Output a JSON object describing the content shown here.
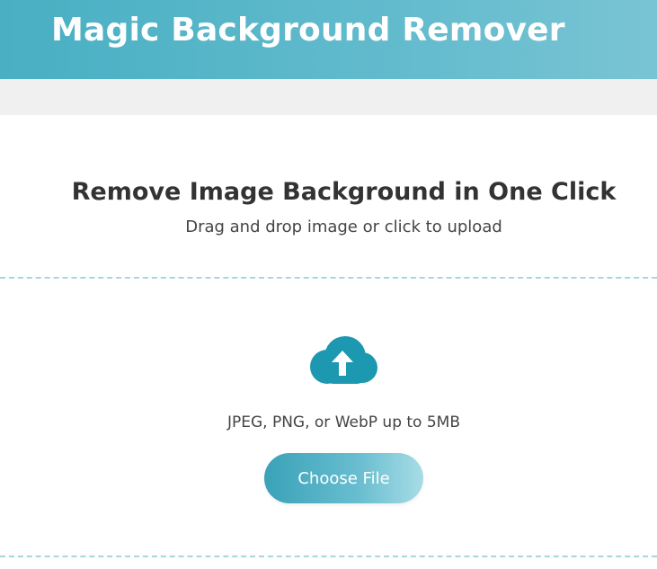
{
  "header": {
    "title": "Magic Background Remover"
  },
  "uploader": {
    "heading": "Remove Image Background in One Click",
    "subheading": "Drag and drop image or click to upload",
    "formats": "JPEG, PNG, or WebP up to 5MB",
    "button_label": "Choose File",
    "icon": "cloud-upload-icon"
  },
  "colors": {
    "header_start": "#49afc3",
    "header_end": "#79c4d4",
    "accent": "#1c98b0",
    "dashed_border": "#a7d6e1",
    "button_start": "#3aa2b8",
    "button_end": "#a8dce6"
  }
}
